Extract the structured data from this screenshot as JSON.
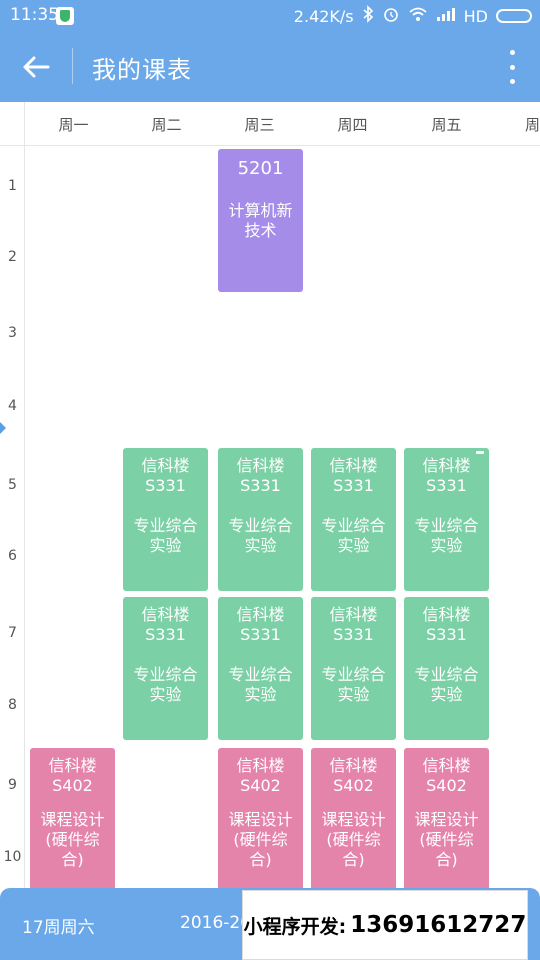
{
  "status_bar": {
    "time": "11:35",
    "network_speed": "2.42K/s",
    "bluetooth_icon": "bluetooth-icon",
    "alarm_icon": "alarm-icon",
    "wifi_icon": "wifi-icon",
    "signal_label": "HD"
  },
  "app_bar": {
    "title": "我的课表",
    "back_icon": "arrow-left-icon",
    "more_icon": "more-vertical-icon"
  },
  "days": [
    "周一",
    "周二",
    "周三",
    "周四",
    "周五",
    "周"
  ],
  "periods": [
    "1",
    "2",
    "3",
    "4",
    "5",
    "6",
    "7",
    "8",
    "9",
    "10"
  ],
  "courses": [
    {
      "location": "5201",
      "name": "计算机新技术",
      "color": "#a58ce8"
    },
    {
      "location": "信科楼S331",
      "name": "专业综合实验",
      "color": "#7cd0a6"
    },
    {
      "location": "信科楼S331",
      "name": "专业综合实验",
      "color": "#7cd0a6"
    },
    {
      "location": "信科楼S331",
      "name": "专业综合实验",
      "color": "#7cd0a6"
    },
    {
      "location": "信科楼S331",
      "name": "专业综合实验",
      "color": "#7cd0a6"
    },
    {
      "location": "信科楼S331",
      "name": "专业综合实验",
      "color": "#7cd0a6"
    },
    {
      "location": "信科楼S331",
      "name": "专业综合实验",
      "color": "#7cd0a6"
    },
    {
      "location": "信科楼S331",
      "name": "专业综合实验",
      "color": "#7cd0a6"
    },
    {
      "location": "信科楼S331",
      "name": "专业综合实验",
      "color": "#7cd0a6"
    },
    {
      "location": "信科楼S402",
      "name": "课程设计(硬件综合)",
      "color": "#e584aa"
    },
    {
      "location": "信科楼S402",
      "name": "课程设计(硬件综合)",
      "color": "#e584aa"
    },
    {
      "location": "信科楼S402",
      "name": "课程设计(硬件综合)",
      "color": "#e584aa"
    },
    {
      "location": "信科楼S402",
      "name": "课程设计(硬件综合)",
      "color": "#e584aa"
    }
  ],
  "bottom_bar": {
    "week": "17周周六",
    "term": "2016-20"
  },
  "promo": {
    "label": "小程序开发:",
    "phone": "13691612727"
  },
  "colors": {
    "primary": "#6aa8ea",
    "purple": "#a58ce8",
    "green": "#7cd0a6",
    "pink": "#e584aa"
  }
}
